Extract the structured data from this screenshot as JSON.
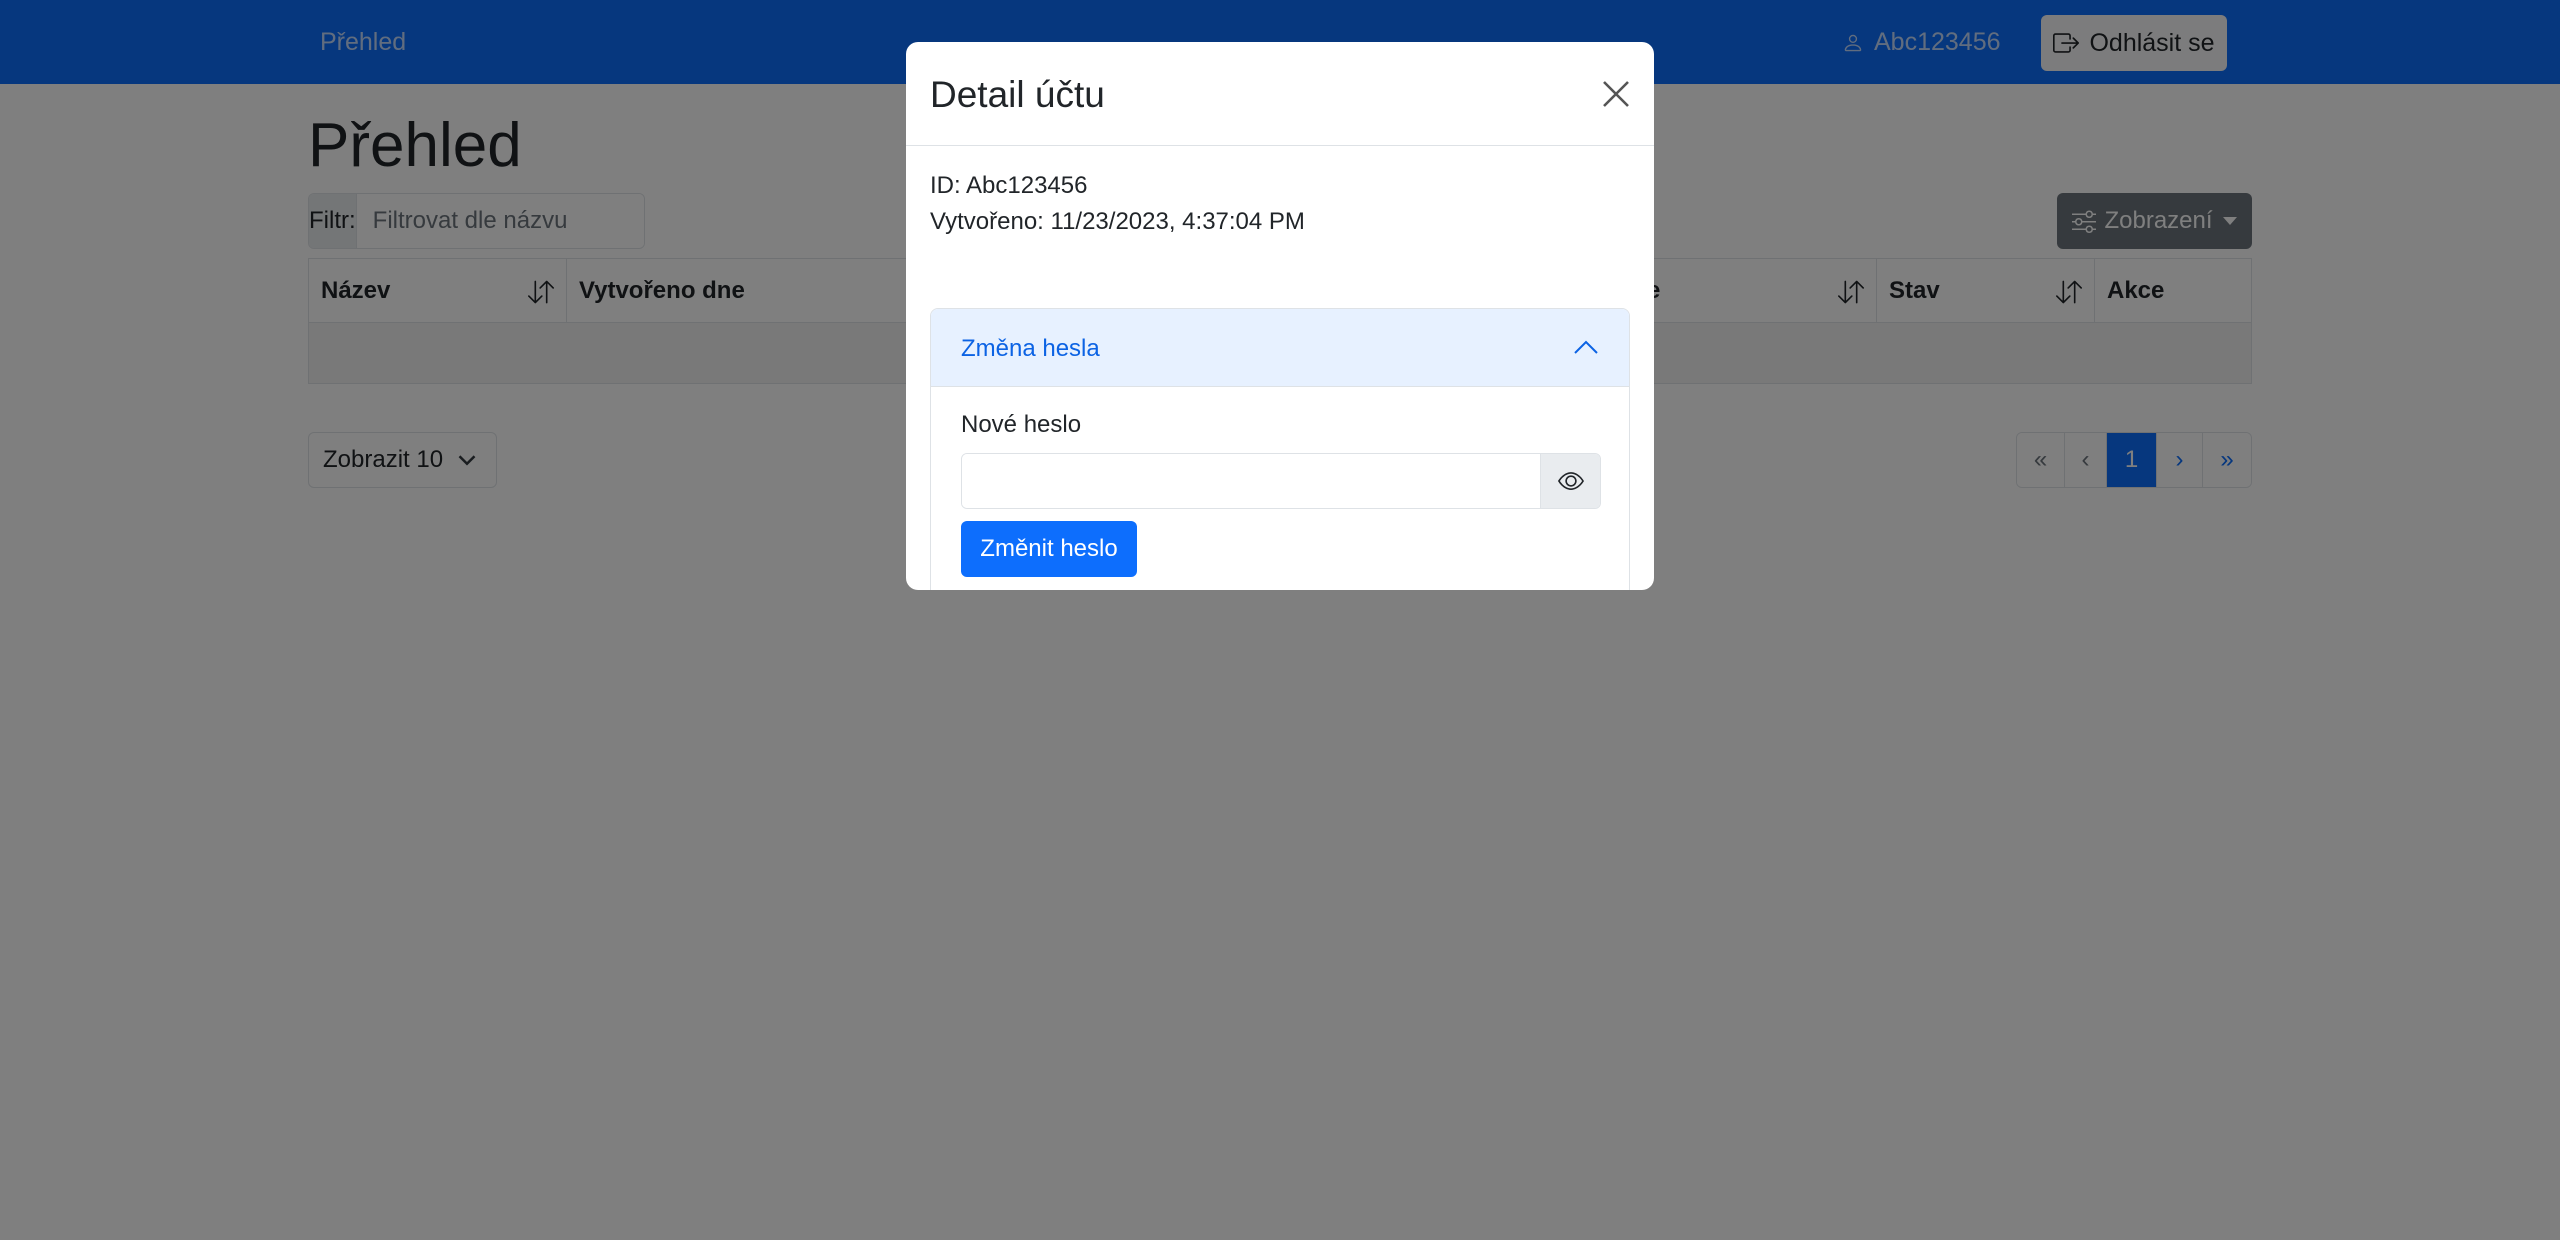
{
  "navbar": {
    "brand": "Přehled",
    "user": "Abc123456",
    "logout_label": "Odhlásit se"
  },
  "page": {
    "title": "Přehled",
    "filter_label": "Filtr:",
    "filter_placeholder": "Filtrovat dle názvu",
    "view_label": "Zobrazení",
    "columns": [
      "Název",
      "Vytvořeno dne",
      "e",
      "Stav",
      "Akce"
    ],
    "page_size_label": "Zobrazit 10",
    "pagination": [
      "«",
      "‹",
      "1",
      "›",
      "»"
    ]
  },
  "modal": {
    "title": "Detail účtu",
    "id_line": "ID: Abc123456",
    "created_line": "Vytvořeno: 11/23/2023, 4:37:04 PM",
    "accordion_title": "Změna hesla",
    "password_label": "Nové heslo",
    "password_value": "",
    "submit_label": "Změnit heslo"
  },
  "colors": {
    "navbar": "#0d6efd",
    "primary": "#0d6efd",
    "accordion_bg": "#e7f1ff",
    "secondary": "#6c757d"
  }
}
